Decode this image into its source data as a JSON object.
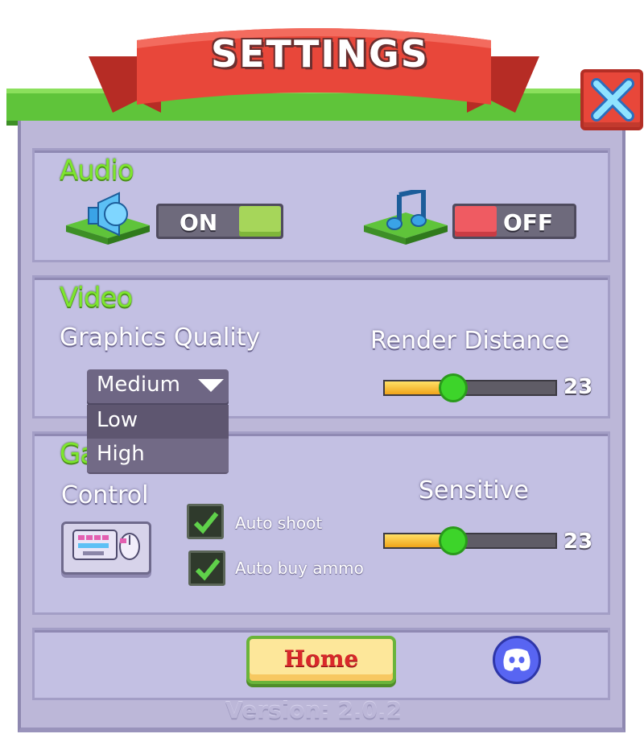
{
  "window": {
    "title": "SETTINGS",
    "close_icon": "close-x-icon"
  },
  "audio": {
    "title": "Audio",
    "sound_toggle": {
      "icon": "speaker-icon",
      "state_label": "ON",
      "on": true,
      "knob_color": "#a6d65a"
    },
    "music_toggle": {
      "icon": "music-note-icon",
      "state_label": "OFF",
      "on": false,
      "knob_color": "#ef5b62"
    }
  },
  "video": {
    "title": "Video",
    "graphics_quality": {
      "label": "Graphics Quality",
      "selected": "Medium",
      "options": [
        "Low",
        "High"
      ]
    },
    "render_distance": {
      "label": "Render Distance",
      "value": "23",
      "fraction": 0.4
    }
  },
  "game": {
    "title": "Ga",
    "control": {
      "label": "Control",
      "icon": "keyboard-mouse-icon"
    },
    "auto_shoot": {
      "label": "Auto shoot",
      "checked": true
    },
    "auto_buy_ammo": {
      "label": "Auto buy ammo",
      "checked": true
    },
    "sensitive": {
      "label": "Sensitive",
      "value": "23",
      "fraction": 0.4
    }
  },
  "footer": {
    "home_label": "Home",
    "discord_icon": "discord-icon",
    "version": "Version: 2.0.2"
  },
  "colors": {
    "board": "#bcb7d8",
    "panel": "#c3c0e3",
    "accent_green": "#7ee62e",
    "close_red": "#e8473a",
    "ribbon_red": "#e8473a"
  }
}
